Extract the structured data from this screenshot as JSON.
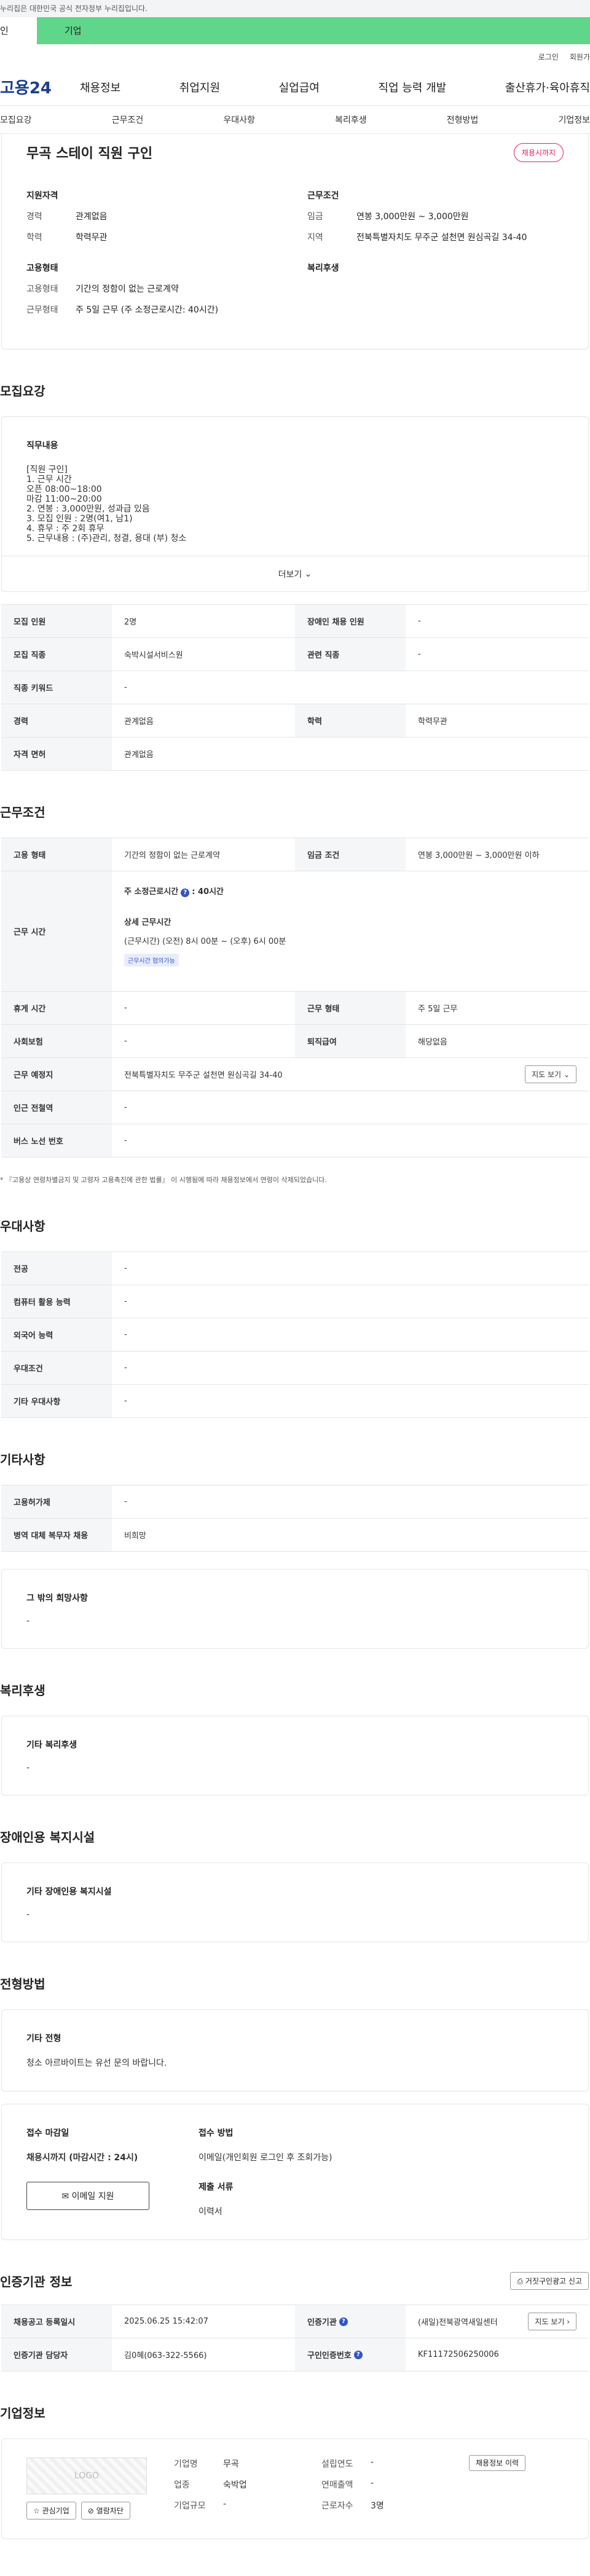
{
  "gov_banner": "누리집은 대한민국 공식 전자정부 누리집입니다.",
  "gov_tabs": [
    "인",
    "기업"
  ],
  "util": [
    "로그인",
    "회원가"
  ],
  "logo": "고용24",
  "main_nav": [
    "채용정보",
    "취업지원",
    "실업급여",
    "직업 능력 개발",
    "출산휴가·육아휴직"
  ],
  "sub_nav": [
    "모집요강",
    "근무조건",
    "우대사항",
    "복리후생",
    "전형방법",
    "기업정보"
  ],
  "summary": {
    "title": "무곡 스테이 직원 구인",
    "badge": "채용시까지",
    "qual_title": "지원자격",
    "qual": [
      [
        "경력",
        "관계없음"
      ],
      [
        "학력",
        "학력무관"
      ]
    ],
    "cond_title": "근무조건",
    "cond": [
      [
        "임금",
        "연봉 3,000만원 ~ 3,000만원"
      ],
      [
        "지역",
        "전북특별자치도 무주군 설천면 원심곡길 34-40"
      ]
    ],
    "emp_title": "고용형태",
    "emp": [
      [
        "고용형태",
        "기간의 정함이 없는 근로계약"
      ],
      [
        "근무형태",
        "주 5일 근무 (주 소정근로시간: 40시간)"
      ]
    ],
    "welfare_title": "복리후생"
  },
  "recruit": {
    "heading": "모집요강",
    "desc_title": "직무내용",
    "desc": "[직원 구인]\n1. 근무 시간\n  오픈 08:00~18:00\n  마감 11:00~20:00\n2. 연봉 : 3,000만원, 성과급 있음\n3. 모집 인원 : 2명(여1, 남1)\n4. 휴무 : 주 2회 휴무\n5. 근무내용 : (주)관리, 청결, 용대 (부) 청소",
    "more": "더보기",
    "rows": [
      [
        [
          "모집 인원",
          "2명"
        ],
        [
          "장애인 채용 인원",
          "-"
        ]
      ],
      [
        [
          "모집 직종",
          "숙박시설서비스원"
        ],
        [
          "관련 직종",
          "-"
        ]
      ],
      [
        [
          "직종 키워드",
          "-"
        ]
      ],
      [
        [
          "경력",
          "관계없음"
        ],
        [
          "학력",
          "학력무관"
        ]
      ],
      [
        [
          "자격 면허",
          "관계없음"
        ]
      ]
    ]
  },
  "work": {
    "heading": "근무조건",
    "emp_type_k": "고용 형태",
    "emp_type_v": "기간의 정함이 없는 근로계약",
    "wage_k": "임금 조건",
    "wage_v": "연봉 3,000만원 ~ 3,000만원 이하",
    "hours_k": "근무 시간",
    "hours_main": "주 소정근로시간",
    "hours_main_val": ": 40시간",
    "hours_detail_t": "상세 근무시간",
    "hours_detail_v": "(근무시간) (오전) 8시 00분 ~ (오후) 6시 00분",
    "hours_chip": "근무시간 협의가능",
    "r1": [
      [
        "휴게 시간",
        "-"
      ],
      [
        "근무 형태",
        "주 5일 근무"
      ]
    ],
    "r2": [
      [
        "사회보험",
        "-"
      ],
      [
        "퇴직급여",
        "해당없음"
      ]
    ],
    "loc_k": "근무 예정지",
    "loc_v": "전북특별자치도 무주군 설천면 원심곡길 34-40",
    "map_btn": "지도 보기",
    "r3": [
      [
        "인근 전철역",
        "-"
      ]
    ],
    "r4": [
      [
        "버스 노선 번호",
        "-"
      ]
    ],
    "note": "* 『고용상 연령차별금지 및 고령자 고용촉진에 관한 법률』 이 시행됨에 따라 채용정보에서 연령이 삭제되었습니다."
  },
  "pref": {
    "heading": "우대사항",
    "rows": [
      [
        "전공",
        "-"
      ],
      [
        "컴퓨터 활용 능력",
        "-"
      ],
      [
        "외국어 능력",
        "-"
      ],
      [
        "우대조건",
        "-"
      ],
      [
        "기타 우대사항",
        "-"
      ]
    ]
  },
  "etc": {
    "heading": "기타사항",
    "rows": [
      [
        "고용허가제",
        "-"
      ],
      [
        "병역 대체 복무자 채용",
        "비희망"
      ]
    ],
    "box_t": "그 밖의 희망사항",
    "box_v": "-"
  },
  "welfare": {
    "heading": "복리후생",
    "box_t": "기타 복리후생",
    "box_v": "-"
  },
  "disab": {
    "heading": "장애인용 복지시설",
    "box_t": "기타 장애인용 복지시설",
    "box_v": "-"
  },
  "screening": {
    "heading": "전형방법",
    "box_t": "기타 전형",
    "box_v": "청소 아르바이트는 유선 문의 바랍니다.",
    "deadline_t": "접수 마감일",
    "deadline_v": "채용시까지 (마감시간 : 24시)",
    "apply_btn": "이메일 지원",
    "method_t": "접수 방법",
    "method_v": "이메일(개인회원 로그인 후 조회가능)",
    "docs_t": "제출 서류",
    "docs_v": "이력서"
  },
  "agency": {
    "heading": "인증기관 정보",
    "report_btn": "거짓구인광고 신고",
    "r1": [
      [
        "채용공고 등록일시",
        "2025.06.25 15:42:07"
      ],
      [
        "인증기관",
        "(새일)전북광역새일센터"
      ]
    ],
    "r2": [
      [
        "인증기관 담당자",
        "김0혜(063-322-5566)"
      ],
      [
        "구인인증번호",
        "KF11172506250006"
      ]
    ],
    "map_btn": "지도 보기"
  },
  "company": {
    "heading": "기업정보",
    "logo_text": "LOGO",
    "fav_btn": "관심기업",
    "block_btn": "열람차단",
    "items": [
      [
        "기업명",
        "무곡"
      ],
      [
        "업종",
        "숙박업"
      ],
      [
        "기업규모",
        "-"
      ]
    ],
    "items2": [
      [
        "설립연도",
        "-"
      ],
      [
        "연매출액",
        "-"
      ],
      [
        "근로자수",
        "3명"
      ]
    ],
    "jobs_btn": "채용정보 이력"
  }
}
